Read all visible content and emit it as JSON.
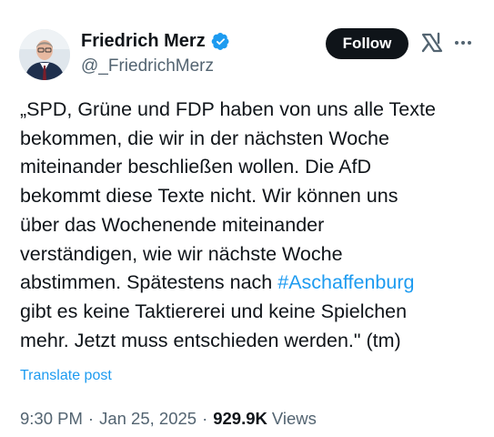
{
  "author": {
    "display_name": "Friedrich Merz",
    "handle": "@_FriedrichMerz",
    "verified": true
  },
  "header": {
    "follow_label": "Follow",
    "grok_icon": "grok-icon",
    "more_icon": "more-horizontal-icon"
  },
  "tweet": {
    "text_before": "„SPD, Grüne und FDP haben von uns alle Texte\nbekommen, die wir in der nächsten Woche\nmiteinander beschließen wollen. Die AfD\nbekommt diese Texte nicht. Wir können uns\nüber das Wochenende miteinander\nverständigen, wie wir nächste Woche\nabstimmen. Spätestens nach ",
    "hashtag": "#Aschaffenburg",
    "text_after": "\ngibt es keine Taktiererei und keine Spielchen\nmehr. Jetzt muss entschieden werden.\" (tm)",
    "translate_label": "Translate post"
  },
  "meta": {
    "time": "9:30 PM",
    "separator": "·",
    "date": "Jan 25, 2025",
    "views_count": "929.9K",
    "views_label": "Views"
  },
  "colors": {
    "accent": "#1d9bf0",
    "text": "#0f1419",
    "secondary": "#536471",
    "button_bg": "#0f1419"
  }
}
